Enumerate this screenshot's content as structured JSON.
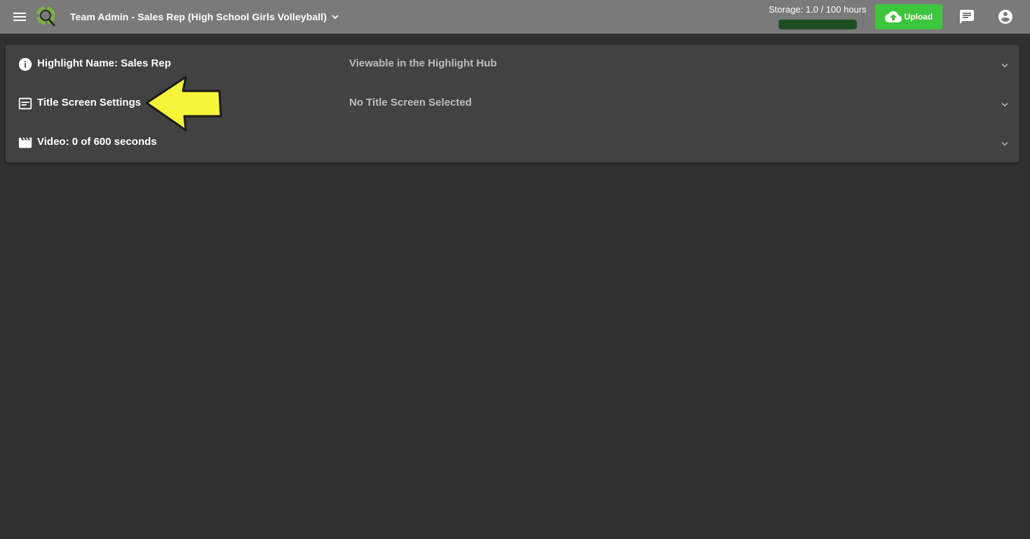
{
  "header": {
    "menu_icon": "hamburger-menu-icon",
    "logo_icon": "app-logo",
    "team_title": "Team Admin - Sales Rep (High School Girls Volleyball)",
    "team_dropdown_icon": "chevron-down-icon",
    "storage_label": "Storage: 1.0 / 100 hours",
    "storage_used_fraction": 0.01,
    "upload_label": "Upload",
    "upload_icon": "cloud-upload-icon",
    "messages_icon": "chat-icon",
    "account_icon": "account-circle-icon"
  },
  "panel": {
    "rows": [
      {
        "icon": "info-icon",
        "title": "Highlight Name: Sales Rep",
        "status": "Viewable in the Highlight Hub",
        "expand_icon": "chevron-down-icon"
      },
      {
        "icon": "subtitles-icon",
        "title": "Title Screen Settings",
        "status": "No Title Screen Selected",
        "expand_icon": "chevron-down-icon"
      },
      {
        "icon": "movie-clapper-icon",
        "title": "Video: 0 of 600 seconds",
        "status": "",
        "expand_icon": "chevron-down-icon"
      }
    ]
  },
  "annotation": {
    "icon": "yellow-arrow-icon",
    "color": "#f5f53a"
  },
  "colors": {
    "topbar": "#7a7a7a",
    "background": "#303030",
    "panel": "#424242",
    "upload_button": "#3ec53e",
    "storage_bar": "#1f4d22"
  }
}
